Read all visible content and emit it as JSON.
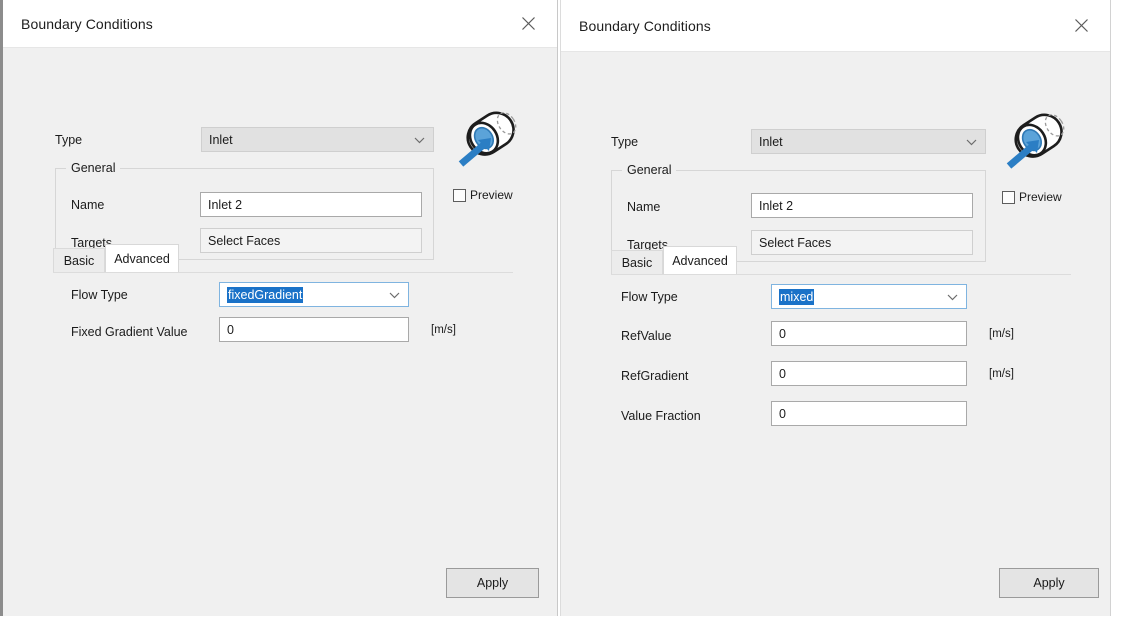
{
  "panels": [
    {
      "title": "Boundary Conditions",
      "close_icon": "close-icon",
      "type_label": "Type",
      "type_value": "Inlet",
      "group_title": "General",
      "name_label": "Name",
      "name_value": "Inlet 2",
      "targets_label": "Targets",
      "targets_value": "Select Faces",
      "preview_label": "Preview",
      "preview_checked": false,
      "pipe_icon": "pipe-inlet-icon",
      "tabs": [
        {
          "label": "Basic",
          "active": false
        },
        {
          "label": "Advanced",
          "active": true
        }
      ],
      "flow_type_label": "Flow Type",
      "flow_type_value": "fixedGradient",
      "fields": [
        {
          "label": "Fixed Gradient Value",
          "value": "0",
          "unit": "[m/s]"
        }
      ],
      "apply_label": "Apply"
    },
    {
      "title": "Boundary Conditions",
      "close_icon": "close-icon",
      "type_label": "Type",
      "type_value": "Inlet",
      "group_title": "General",
      "name_label": "Name",
      "name_value": "Inlet 2",
      "targets_label": "Targets",
      "targets_value": "Select Faces",
      "preview_label": "Preview",
      "preview_checked": false,
      "pipe_icon": "pipe-inlet-icon",
      "tabs": [
        {
          "label": "Basic",
          "active": false
        },
        {
          "label": "Advanced",
          "active": true
        }
      ],
      "flow_type_label": "Flow Type",
      "flow_type_value": "mixed",
      "fields": [
        {
          "label": "RefValue",
          "value": "0",
          "unit": "[m/s]"
        },
        {
          "label": "RefGradient",
          "value": "0",
          "unit": "[m/s]"
        },
        {
          "label": "Value Fraction",
          "value": "0",
          "unit": ""
        }
      ],
      "apply_label": "Apply"
    }
  ],
  "colors": {
    "accent_blue": "#1a72c8",
    "arrow_blue": "#2b7ec4",
    "dialog_bg": "#f0f0f0",
    "titlebar_bg": "#ffffff",
    "field_bg": "#ffffff",
    "combo_disabled_bg": "#e1e1e1"
  }
}
